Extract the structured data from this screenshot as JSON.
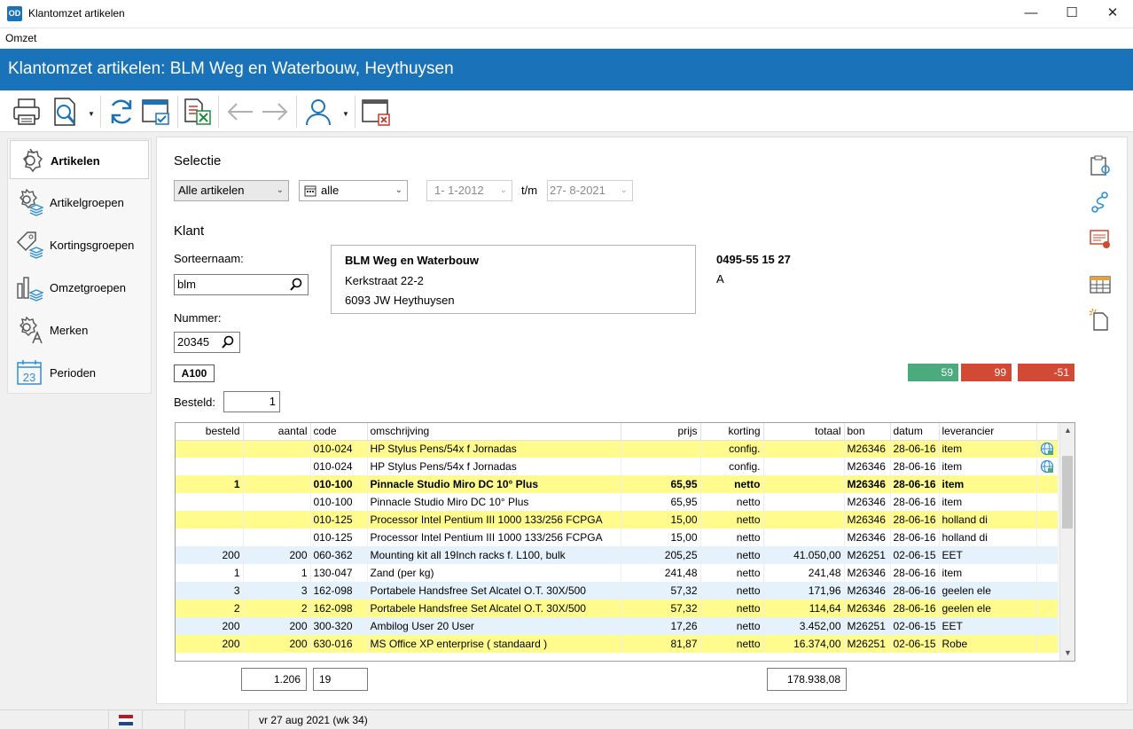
{
  "window": {
    "title": "Klantomzet artikelen",
    "logo": "OD",
    "minimize_glyph": "—",
    "maximize_glyph": "☐",
    "close_glyph": "✕"
  },
  "menu": {
    "items": [
      "Omzet"
    ]
  },
  "header": {
    "title": "Klantomzet artikelen: BLM Weg en Waterbouw, Heythuysen",
    "color": "#1a73b8"
  },
  "sidebar": {
    "items": [
      {
        "label": "Artikelen",
        "icon": "gear-icon",
        "active": true
      },
      {
        "label": "Artikelgroepen",
        "icon": "gear-layers-icon"
      },
      {
        "label": "Kortingsgroepen",
        "icon": "tag-layers-icon"
      },
      {
        "label": "Omzetgroepen",
        "icon": "bar-chart-layers-icon"
      },
      {
        "label": "Merken",
        "icon": "gear-letter-icon"
      },
      {
        "label": "Perioden",
        "icon": "calendar-icon"
      }
    ]
  },
  "selectie": {
    "heading": "Selectie",
    "articles": "Alle artikelen",
    "period": "alle",
    "date_from": "1-  1-2012",
    "tm_label": "t/m",
    "date_to": "27-  8-2021"
  },
  "klant": {
    "heading": "Klant",
    "sorteernaam_label": "Sorteernaam:",
    "sorteernaam": "blm",
    "nummer_label": "Nummer:",
    "nummer": "20345",
    "address_name": "BLM Weg en Waterbouw",
    "address_street": "Kerkstraat 22-2",
    "address_city": "6093 JW   Heythuysen",
    "phone": "0495-55 15 27",
    "code": "A",
    "tag": "A100"
  },
  "badges": [
    {
      "value": "59",
      "color": "#4caa7f"
    },
    {
      "value": "99",
      "color": "#d04a34"
    },
    {
      "value": "-51",
      "color": "#d04a34"
    }
  ],
  "besteld": {
    "label": "Besteld:",
    "value": "1"
  },
  "table": {
    "columns": [
      "besteld",
      "aantal",
      "code",
      "omschrijving",
      "prijs",
      "korting",
      "totaal",
      "bon",
      "datum",
      "leverancier"
    ],
    "rows": [
      {
        "style": "yellow",
        "cells": [
          "",
          "",
          "010-024",
          "HP Stylus Pens/54x f Jornadas",
          "",
          "config.",
          "",
          "M26346",
          "28-06-16",
          "item"
        ],
        "globe": true
      },
      {
        "style": "white",
        "cells": [
          "",
          "",
          "010-024",
          "HP Stylus Pens/54x f Jornadas",
          "",
          "config.",
          "",
          "M26346",
          "28-06-16",
          "item"
        ],
        "globe": true
      },
      {
        "style": "yellow bold",
        "cells": [
          "1",
          "",
          "010-100",
          "Pinnacle Studio Miro DC 10° Plus",
          "65,95",
          "netto",
          "",
          "M26346",
          "28-06-16",
          "item"
        ]
      },
      {
        "style": "white",
        "cells": [
          "",
          "",
          "010-100",
          "Pinnacle Studio Miro DC 10° Plus",
          "65,95",
          "netto",
          "",
          "M26346",
          "28-06-16",
          "item"
        ]
      },
      {
        "style": "yellow",
        "cells": [
          "",
          "",
          "010-125",
          "Processor Intel Pentium III 1000 133/256 FCPGA",
          "15,00",
          "netto",
          "",
          "M26346",
          "28-06-16",
          "holland di"
        ]
      },
      {
        "style": "white",
        "cells": [
          "",
          "",
          "010-125",
          "Processor Intel Pentium III 1000 133/256 FCPGA",
          "15,00",
          "netto",
          "",
          "M26346",
          "28-06-16",
          "holland di"
        ]
      },
      {
        "style": "blue",
        "cells": [
          "200",
          "200",
          "060-362",
          "Mounting kit all 19Inch racks f. L100, bulk",
          "205,25",
          "netto",
          "41.050,00",
          "M26251",
          "02-06-15",
          "EET"
        ]
      },
      {
        "style": "white",
        "cells": [
          "1",
          "1",
          "130-047",
          "Zand (per kg)",
          "241,48",
          "netto",
          "241,48",
          "M26346",
          "28-06-16",
          "item"
        ]
      },
      {
        "style": "blue",
        "cells": [
          "3",
          "3",
          "162-098",
          "Portabele Handsfree Set Alcatel O.T. 30X/500",
          "57,32",
          "netto",
          "171,96",
          "M26346",
          "28-06-16",
          "geelen ele"
        ]
      },
      {
        "style": "yellow",
        "cells": [
          "2",
          "2",
          "162-098",
          "Portabele Handsfree Set Alcatel O.T. 30X/500",
          "57,32",
          "netto",
          "114,64",
          "M26346",
          "28-06-16",
          "geelen ele"
        ]
      },
      {
        "style": "blue",
        "cells": [
          "200",
          "200",
          "300-320",
          "Ambilog User 20 User",
          "17,26",
          "netto",
          "3.452,00",
          "M26251",
          "02-06-15",
          "EET"
        ]
      },
      {
        "style": "yellow",
        "cells": [
          "200",
          "200",
          "630-016",
          "MS Office XP enterprise ( standaard )",
          "81,87",
          "netto",
          "16.374,00",
          "M26251",
          "02-06-15",
          "Robe"
        ]
      }
    ]
  },
  "totals": {
    "aantal": "1.206",
    "count": "19",
    "totaal": "178.938,08"
  },
  "status": {
    "date": "vr 27 aug 2021 (wk 34)"
  }
}
